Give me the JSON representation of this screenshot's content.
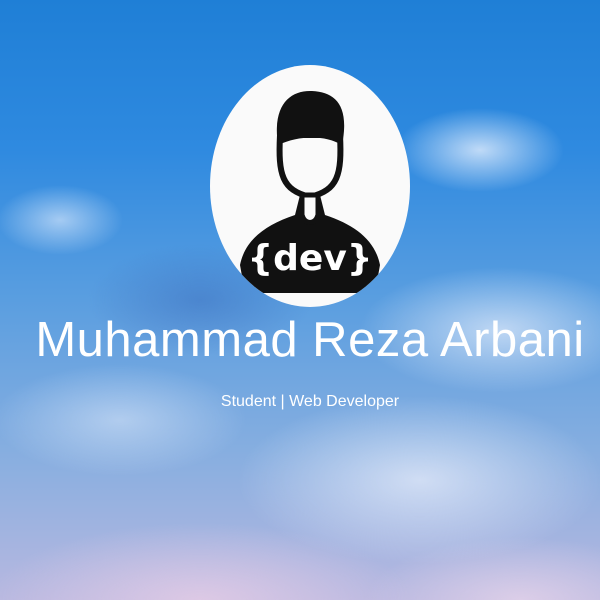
{
  "profile": {
    "avatar_label": "{dev}",
    "name": "Muhammad Reza Arbani",
    "role": "Student | Web Developer"
  },
  "colors": {
    "sky": "#2f8ae0",
    "text": "#ffffff"
  }
}
